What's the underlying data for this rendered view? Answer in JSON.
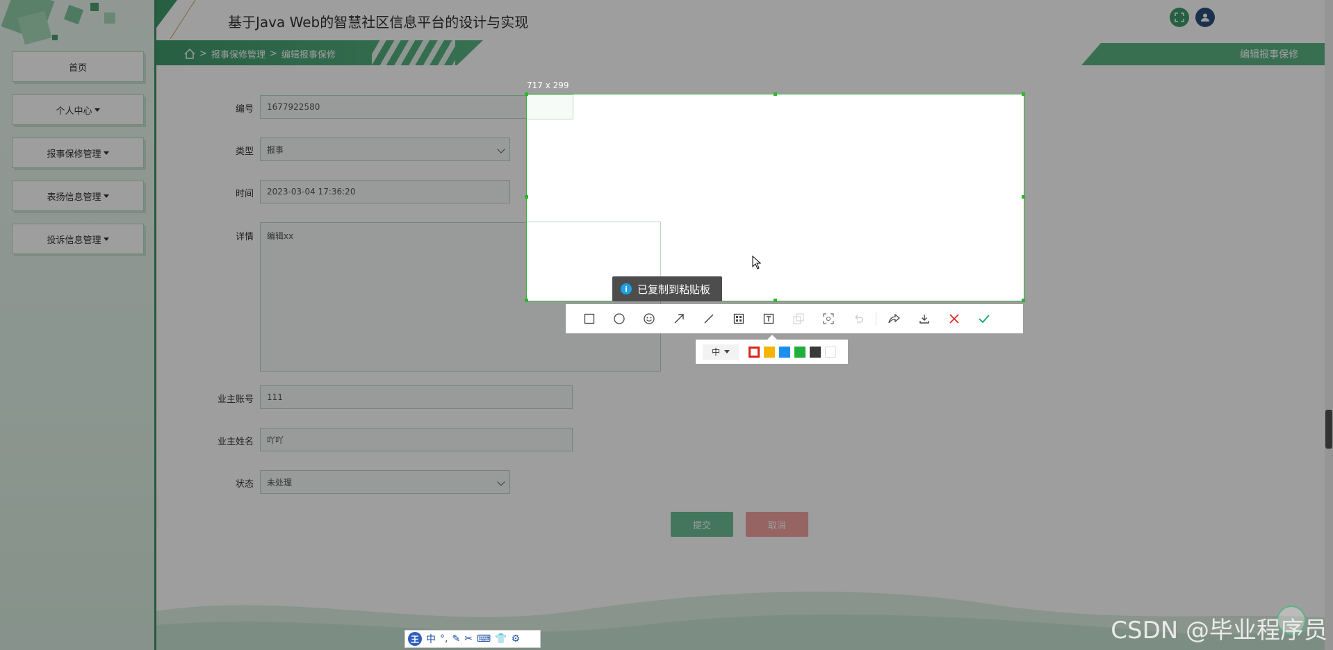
{
  "app": {
    "title": "基于Java Web的智慧社区信息平台的设计与实现"
  },
  "sidebar": {
    "items": [
      {
        "label": "首页",
        "dropdown": false
      },
      {
        "label": "个人中心",
        "dropdown": true
      },
      {
        "label": "报事保修管理",
        "dropdown": true
      },
      {
        "label": "表扬信息管理",
        "dropdown": true
      },
      {
        "label": "投诉信息管理",
        "dropdown": true
      }
    ]
  },
  "breadcrumb": {
    "home_icon": "home-icon",
    "items": [
      "报事保修管理",
      "编辑报事保修"
    ],
    "separator": ">"
  },
  "header": {
    "right_tab": "编辑报事保修",
    "icons": [
      "fullscreen-icon",
      "user-icon"
    ]
  },
  "form": {
    "fields": {
      "number": {
        "label": "编号",
        "value": "1677922580"
      },
      "type": {
        "label": "类型",
        "value": "报事"
      },
      "time": {
        "label": "时间",
        "value": "2023-03-04 17:36:20"
      },
      "detail": {
        "label": "详情",
        "value": "编辑xx"
      },
      "owner_account": {
        "label": "业主账号",
        "value": "111"
      },
      "owner_name": {
        "label": "业主姓名",
        "value": "吖吖"
      },
      "status": {
        "label": "状态",
        "value": "未处理"
      }
    },
    "submit_label": "提交",
    "cancel_label": "取消"
  },
  "screenshot_tool": {
    "size_label": "717 x 299",
    "toast": "已复制到粘贴板",
    "toolbar": [
      "rectangle-icon",
      "ellipse-icon",
      "emoji-icon",
      "arrow-icon",
      "line-icon",
      "mosaic-icon",
      "text-icon",
      "layers-icon",
      "ocr-icon",
      "undo-icon",
      "share-icon",
      "download-icon",
      "close-icon",
      "confirm-icon"
    ],
    "size_option": "中",
    "colors": [
      "#d9231b",
      "#f5b400",
      "#1a8ff0",
      "#1fae3a",
      "#3a3a3a",
      "#ffffff"
    ]
  },
  "ime_bar": {
    "logo": "王",
    "mode": "中"
  },
  "watermark": "CSDN @毕业程序员"
}
